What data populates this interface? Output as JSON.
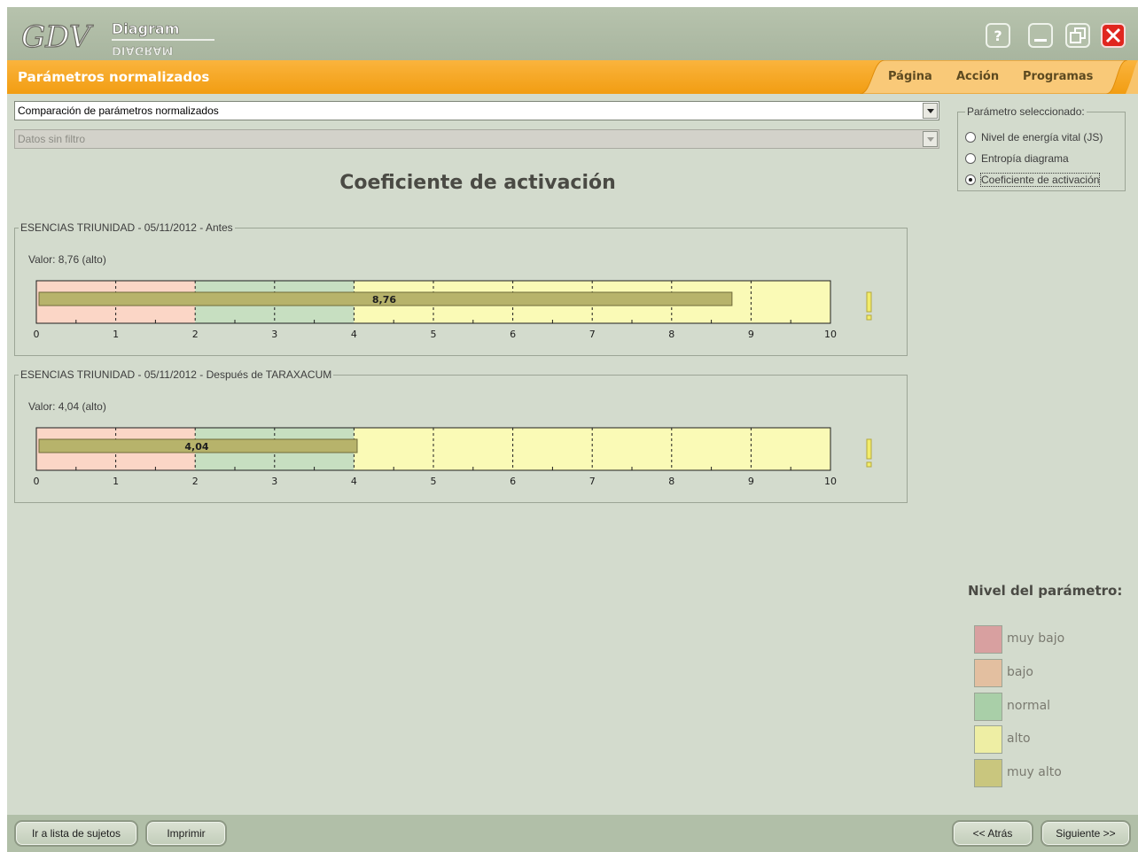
{
  "app": {
    "logo_brand": "GDV",
    "logo_word": "Diagram",
    "logo_word_mirrored": "DIAGRAM"
  },
  "window_controls": [
    "help-icon",
    "minimize-icon",
    "restore-icon",
    "close-icon"
  ],
  "menubar": {
    "section_title": "Parámetros normalizados",
    "items": [
      "Página",
      "Acción",
      "Programas"
    ]
  },
  "comparison_select": {
    "value": "Comparación de parámetros normalizados"
  },
  "filter_select": {
    "value": "Datos sin filtro",
    "disabled": true
  },
  "main_title": "Coeficiente de activación",
  "parameter_group": {
    "legend": "Parámetro seleccionado:",
    "options": [
      {
        "label": "Nivel de energía vital (JS)",
        "checked": false
      },
      {
        "label": "Entropía diagrama",
        "checked": false
      },
      {
        "label": "Coeficiente de activación",
        "checked": true
      }
    ]
  },
  "measurements": [
    {
      "legend": "ESENCIAS TRIUNIDAD - 05/11/2012 - Antes",
      "value_text": "Valor: 8,76 (alto)",
      "bar_label": "8,76"
    },
    {
      "legend": "ESENCIAS TRIUNIDAD - 05/11/2012 - Después de TARAXACUM",
      "value_text": "Valor: 4,04 (alto)",
      "bar_label": "4,04"
    }
  ],
  "chart_data": [
    {
      "type": "bar",
      "orientation": "horizontal",
      "title": "ESENCIAS TRIUNIDAD - 05/11/2012 - Antes",
      "values": [
        8.76
      ],
      "xlim": [
        0,
        10
      ],
      "x_ticks": [
        "0",
        "1",
        "2",
        "3",
        "4",
        "5",
        "6",
        "7",
        "8",
        "9",
        "10"
      ],
      "zones": [
        {
          "from": 0,
          "to": 2,
          "color": "#fbd6c6"
        },
        {
          "from": 2,
          "to": 4,
          "color": "#c7dfc1"
        },
        {
          "from": 4,
          "to": 10,
          "color": "#fafab6"
        }
      ],
      "bar_color": "#b7b36b",
      "warning_color": "#f2ec6a"
    },
    {
      "type": "bar",
      "orientation": "horizontal",
      "title": "ESENCIAS TRIUNIDAD - 05/11/2012 - Después de TARAXACUM",
      "values": [
        4.04
      ],
      "xlim": [
        0,
        10
      ],
      "x_ticks": [
        "0",
        "1",
        "2",
        "3",
        "4",
        "5",
        "6",
        "7",
        "8",
        "9",
        "10"
      ],
      "zones": [
        {
          "from": 0,
          "to": 2,
          "color": "#fbd6c6"
        },
        {
          "from": 2,
          "to": 4,
          "color": "#c7dfc1"
        },
        {
          "from": 4,
          "to": 10,
          "color": "#fafab6"
        }
      ],
      "bar_color": "#b7b36b",
      "warning_color": "#f2ec6a"
    }
  ],
  "level_legend": {
    "title": "Nivel del parámetro:",
    "items": [
      {
        "label": "muy bajo",
        "color": "#d8a0a0"
      },
      {
        "label": "bajo",
        "color": "#e3bfa0"
      },
      {
        "label": "normal",
        "color": "#a9cfa8"
      },
      {
        "label": "alto",
        "color": "#eeeea4"
      },
      {
        "label": "muy alto",
        "color": "#c9c67e"
      }
    ]
  },
  "bottom_bar": {
    "subjects_button": "Ir a lista de sujetos",
    "print_button": "Imprimir",
    "back_button": "<< Atrás",
    "next_button": "Siguiente >>"
  },
  "colors": {
    "background": "#d3dbcd",
    "titlebar": "#a8b59f",
    "menubar": "#f6a41f",
    "close_button": "#e0261f"
  }
}
